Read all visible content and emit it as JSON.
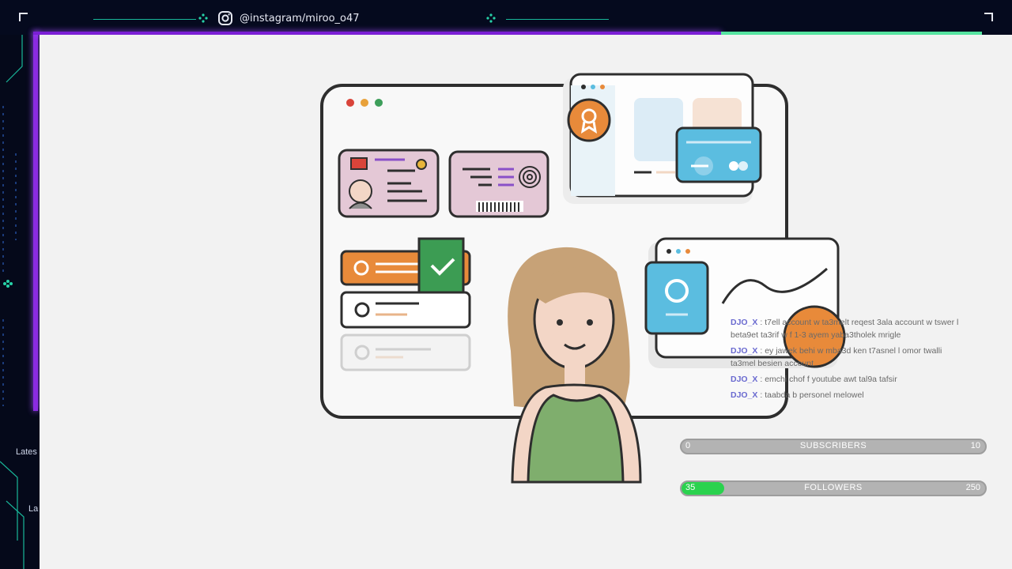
{
  "overlay": {
    "instagram_handle": "@instagram/miroo_o47",
    "side_labels": [
      "Lates",
      "La"
    ]
  },
  "chat": [
    {
      "user": "DJO_X",
      "text": ": t7ell account w ta3melt reqest 3ala account w tswer l beta9et ta3rif w f 1-3 ayem yaba3tholek mriglе"
    },
    {
      "user": "DJO_X",
      "text": ": ey jawek behi w mba3d ken t7asnel l omor twalli ta3mel besien account"
    },
    {
      "user": "DJO_X",
      "text": ": emchi chof f youtube awt tal9a tafsir"
    },
    {
      "user": "DJO_X",
      "text": ": taabda b personel melowel"
    }
  ],
  "stats": {
    "subscribers": {
      "label": "SUBSCRIBERS",
      "current": "0",
      "goal": "10",
      "progress": 0.0
    },
    "followers": {
      "label": "FOLLOWERS",
      "current": "35",
      "goal": "250",
      "progress": 0.14
    }
  },
  "colors": {
    "neon_purple": "#8a2be2",
    "neon_green": "#55e3a0",
    "progress_green": "#2ad24e",
    "circuit_teal": "#19b89a",
    "chat_user": "#6a6ad0"
  }
}
